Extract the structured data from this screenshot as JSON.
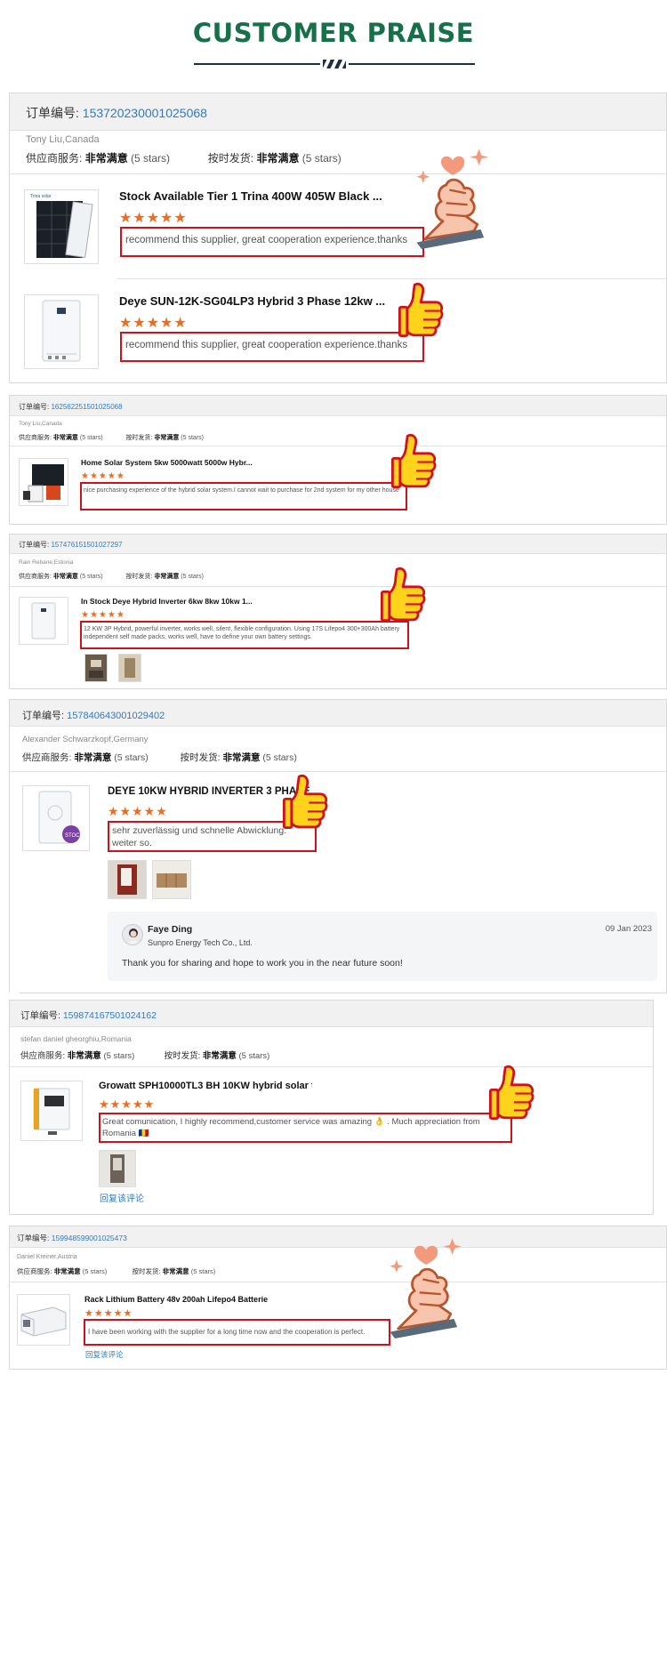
{
  "page_title": "CUSTOMER PRAISE",
  "order_label": "订单编号:",
  "ratings": {
    "supplier_label": "供应商服务:",
    "delivery_label": "按时发货:",
    "value": "非常满意",
    "stars_text": "(5 stars)"
  },
  "stars": "★★★★★",
  "reviews": [
    {
      "order_no": "153720230001025068",
      "buyer": "Tony Liu,Canada",
      "products": [
        {
          "title": "Stock Available Tier 1 Trina 400W 405W Black ...",
          "review": "recommend this supplier, great cooperation experience.thanks",
          "thumb_brand": "Trina solar"
        },
        {
          "title": "Deye SUN-12K-SG04LP3 Hybrid 3 Phase 12kw ...",
          "review": "recommend this supplier, great cooperation experience.thanks"
        }
      ]
    },
    {
      "order_no": "162562251501025068",
      "buyer": "Tony Liu,Canada",
      "title": "Home Solar System 5kw 5000watt 5000w Hybr...",
      "review": "nice purchasing experience of the hybrid solar system.I cannot wait to purchase for 2nd system for my other house"
    },
    {
      "order_no": "157476151501027297",
      "buyer": "Rain Rebane,Estonia",
      "title": "In Stock Deye Hybrid Inverter 6kw 8kw 10kw 1...",
      "review": "12 KW 3P Hybrid, powerful inverter, works well, silent, flexible configuration. Using 17S Lifepo4 300+300Ah battery independent self made packs, works well, have to define your own battery settings."
    },
    {
      "order_no": "157840643001029402",
      "buyer": "Alexander Schwarzkopf,Germany",
      "title": "DEYE 10KW HYBRID INVERTER 3 PHASE",
      "review": "sehr zuverlässig und schnelle Abwicklung. weiter so.",
      "thumb_badge": "STOCK",
      "reply": {
        "name": "Faye Ding",
        "company": "Sunpro Energy Tech Co., Ltd.",
        "date": "09 Jan 2023",
        "text": "Thank you for sharing and hope to work you in the near future soon!"
      }
    },
    {
      "order_no": "159874167501024162",
      "buyer": "stefan daniel gheorghiu,Romania",
      "title": "Growatt SPH10000TL3 BH 10KW hybrid solar t...",
      "review": "Great comunication, I highly recommend,customer service was amazing 👌 . Much appreciation from Romania 🇷🇴",
      "link": "回复该评论"
    },
    {
      "order_no": "159948599001025473",
      "buyer": "Daniel Kreiner,Austria",
      "title": "Rack Lithium Battery 48v 200ah Lifepo4 Batterie",
      "review": "I have been working with the supplier for a long time now and the cooperation is perfect.",
      "link": "回复该评论"
    }
  ],
  "colors": {
    "title_green": "#16714a",
    "link_blue": "#2e7bc4",
    "star_orange": "#ef6c1e",
    "highlight_red": "#d0101a",
    "thumb_yellow": "#ffd21c"
  }
}
